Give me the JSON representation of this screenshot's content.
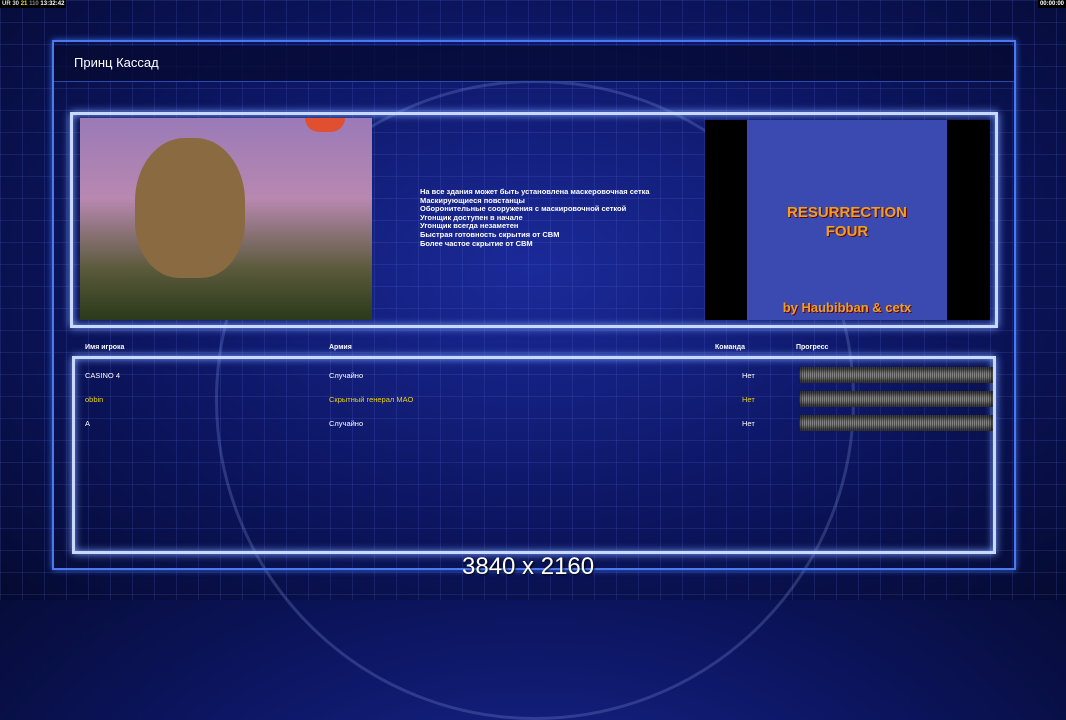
{
  "hud": {
    "left_segments": [
      "UR",
      "30",
      "21",
      "110"
    ],
    "clock": "13:32:42",
    "right_timer": "00:00:00"
  },
  "title": "Принц Кассад",
  "features": [
    "На все здания может быть установлена маскеровочная сетка",
    "Маскирующиеся повстанцы",
    "Оборонительные сооружения с маскировочной сеткой",
    "Угонщик доступен в начале",
    "Угонщик всегда незаметен",
    "Быстрая готовность скрытия от СВМ",
    "Более частое скрытие от СВМ"
  ],
  "map_logo": {
    "line1": "RESURRECTION",
    "line2": "FOUR",
    "credit": "by Haubibban & cetx"
  },
  "table": {
    "headers": {
      "player": "Имя игрока",
      "army": "Армия",
      "team": "Команда",
      "progress": "Прогресс"
    },
    "rows": [
      {
        "player": "CASINO 4",
        "army": "Случайно",
        "team": "Нет",
        "progress": 0,
        "color": "#ffffff"
      },
      {
        "player": "obbin",
        "army": "Скрытный генерал МАО",
        "team": "Нет",
        "progress": 0,
        "color": "#e8d020"
      },
      {
        "player": "A",
        "army": "Случайно",
        "team": "Нет",
        "progress": 0,
        "color": "#ffffff"
      }
    ]
  },
  "resolution_label": "3840 x 2160"
}
